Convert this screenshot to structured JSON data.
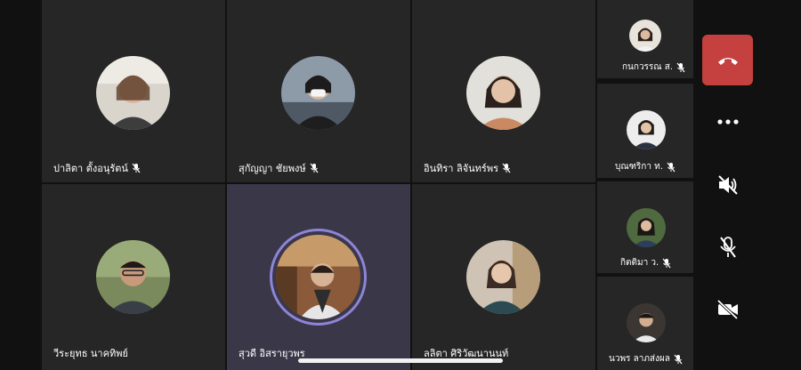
{
  "participants": [
    {
      "name": "ปาลิตา  ตั้งอนุรัตน์",
      "muted": true,
      "active": false
    },
    {
      "name": "สุกัญญา  ชัยพงษ์",
      "muted": true,
      "active": false
    },
    {
      "name": "อินทิรา  ลิจันทร์พร",
      "muted": true,
      "active": false
    },
    {
      "name": "วีระยุทธ  นาคทิพย์",
      "muted": false,
      "active": false
    },
    {
      "name": "สุวดี  อิสรายุวพร",
      "muted": false,
      "active": true
    },
    {
      "name": "ลลิตา  ศิริวัฒนานนท์",
      "muted": false,
      "active": false
    }
  ],
  "side_participants": [
    {
      "name": "กนกวรรณ ส.",
      "muted": true
    },
    {
      "name": "บุณฑริกา ท.",
      "muted": true
    },
    {
      "name": "กิตติมา ว.",
      "muted": true
    },
    {
      "name": "นวพร  ลาภส่งผล",
      "muted": true
    }
  ],
  "controls": {
    "end_call_color": "#c4413f",
    "buttons": [
      "more-icon",
      "speaker-muted-icon",
      "mic-muted-icon",
      "camera-off-icon"
    ]
  },
  "colors": {
    "tile_bg": "#262626",
    "active_tile_bg": "#3a3848",
    "active_ring": "#8e84d8"
  }
}
